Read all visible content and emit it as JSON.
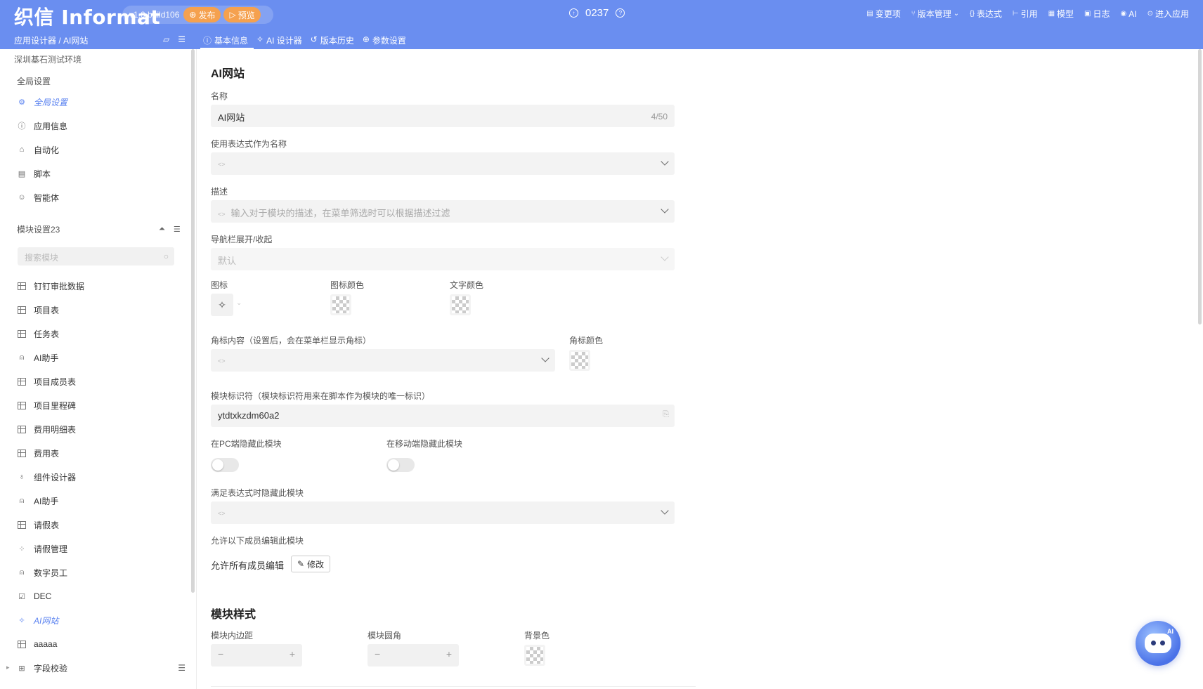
{
  "header": {
    "logo": "织信 Informat",
    "version": "v1.0 build106",
    "publish_label": "发布",
    "preview_label": "预览",
    "counter": "0237",
    "menu": [
      {
        "label": "变更项",
        "icon": "list-icon"
      },
      {
        "label": "版本管理",
        "icon": "branch-icon"
      },
      {
        "label": "表达式",
        "icon": "braces-icon"
      },
      {
        "label": "引用",
        "icon": "tree-icon"
      },
      {
        "label": "模型",
        "icon": "table-icon"
      },
      {
        "label": "日志",
        "icon": "log-icon"
      },
      {
        "label": "AI",
        "icon": "ai-icon"
      },
      {
        "label": "进入应用",
        "icon": "enter-icon"
      }
    ],
    "breadcrumb": "应用设计器 / AI网站",
    "tabs": [
      {
        "label": "基本信息",
        "icon": "info-icon"
      },
      {
        "label": "AI 设计器",
        "icon": "magic-icon"
      },
      {
        "label": "版本历史",
        "icon": "history-icon"
      },
      {
        "label": "参数设置",
        "icon": "gear-icon"
      }
    ]
  },
  "sidebar": {
    "env": "深圳基石测试环境",
    "global_title": "全局设置",
    "global_items": [
      {
        "label": "全局设置",
        "icon": "gear-icon"
      },
      {
        "label": "应用信息",
        "icon": "info-icon"
      },
      {
        "label": "自动化",
        "icon": "robot-icon"
      },
      {
        "label": "脚本",
        "icon": "script-icon"
      },
      {
        "label": "智能体",
        "icon": "agent-icon"
      }
    ],
    "modules_title": "模块设置23",
    "search_placeholder": "搜索模块",
    "modules": [
      {
        "label": "钉钉审批数据",
        "icon": "table-icon"
      },
      {
        "label": "项目表",
        "icon": "table-icon"
      },
      {
        "label": "任务表",
        "icon": "table-icon"
      },
      {
        "label": "AI助手",
        "icon": "robot-icon"
      },
      {
        "label": "项目成员表",
        "icon": "table-icon"
      },
      {
        "label": "项目里程碑",
        "icon": "table-icon"
      },
      {
        "label": "费用明细表",
        "icon": "table-icon"
      },
      {
        "label": "费用表",
        "icon": "table-icon"
      },
      {
        "label": "组件设计器",
        "icon": "component-icon"
      },
      {
        "label": "AI助手",
        "icon": "robot-icon"
      },
      {
        "label": "请假表",
        "icon": "table-icon"
      },
      {
        "label": "请假管理",
        "icon": "workflow-icon"
      },
      {
        "label": "数字员工",
        "icon": "robot-icon"
      },
      {
        "label": "DEC",
        "icon": "edit-icon"
      },
      {
        "label": "AI网站",
        "icon": "magic-icon"
      },
      {
        "label": "aaaaa",
        "icon": "table-icon"
      },
      {
        "label": "字段校验",
        "icon": "folder-icon"
      }
    ]
  },
  "main": {
    "title": "AI网站",
    "name_label": "名称",
    "name_value": "AI网站",
    "name_count": "4/50",
    "expr_name_label": "使用表达式作为名称",
    "desc_label": "描述",
    "desc_placeholder": "输入对于模块的描述，在菜单筛选时可以根据描述过滤",
    "nav_label": "导航栏展开/收起",
    "nav_value": "默认",
    "icon_label": "图标",
    "icon_color_label": "图标颜色",
    "text_color_label": "文字颜色",
    "badge_label": "角标内容（设置后，会在菜单栏显示角标）",
    "badge_color_label": "角标颜色",
    "key_label": "模块标识符（模块标识符用来在脚本作为模块的唯一标识）",
    "key_value": "ytdtxkzdm60a2",
    "hide_pc_label": "在PC端隐藏此模块",
    "hide_mobile_label": "在移动端隐藏此模块",
    "hide_expr_label": "满足表达式时隐藏此模块",
    "allow_label": "允许以下成员编辑此模块",
    "allow_value": "允许所有成员编辑",
    "edit_label": "修改",
    "style_title": "模块样式",
    "padding_label": "模块内边距",
    "radius_label": "模块圆角",
    "bg_label": "背景色"
  },
  "colors": {
    "header_bg": "#6a8ef0",
    "accent": "#5a82f0",
    "publish": "#f5a14f"
  }
}
